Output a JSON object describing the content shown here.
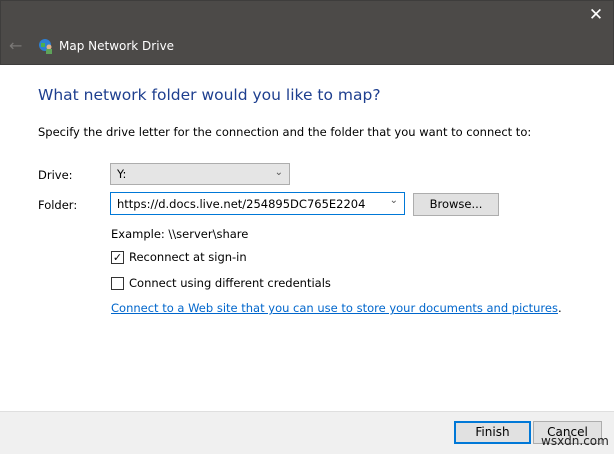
{
  "window": {
    "close_glyph": "✕",
    "back_glyph": "←",
    "title": "Map Network Drive"
  },
  "heading": "What network folder would you like to map?",
  "instruction": "Specify the drive letter for the connection and the folder that you want to connect to:",
  "drive": {
    "label": "Drive:",
    "value": "Y:"
  },
  "folder": {
    "label": "Folder:",
    "value": "https://d.docs.live.net/254895DC765E2204",
    "browse_label": "Browse..."
  },
  "example": "Example: \\\\server\\share",
  "reconnect": {
    "label": "Reconnect at sign-in",
    "checked": true,
    "mark": "✓"
  },
  "credentials": {
    "label": "Connect using different credentials",
    "checked": false
  },
  "link": "Connect to a Web site that you can use to store your documents and pictures",
  "link_suffix": ".",
  "buttons": {
    "finish": "Finish",
    "cancel": "Cancel"
  },
  "watermark": "wsxdn.com",
  "colors": {
    "titlebar": "#4c4a48",
    "heading": "#1e3f8f",
    "link": "#0066cc",
    "focus": "#0078d7"
  }
}
